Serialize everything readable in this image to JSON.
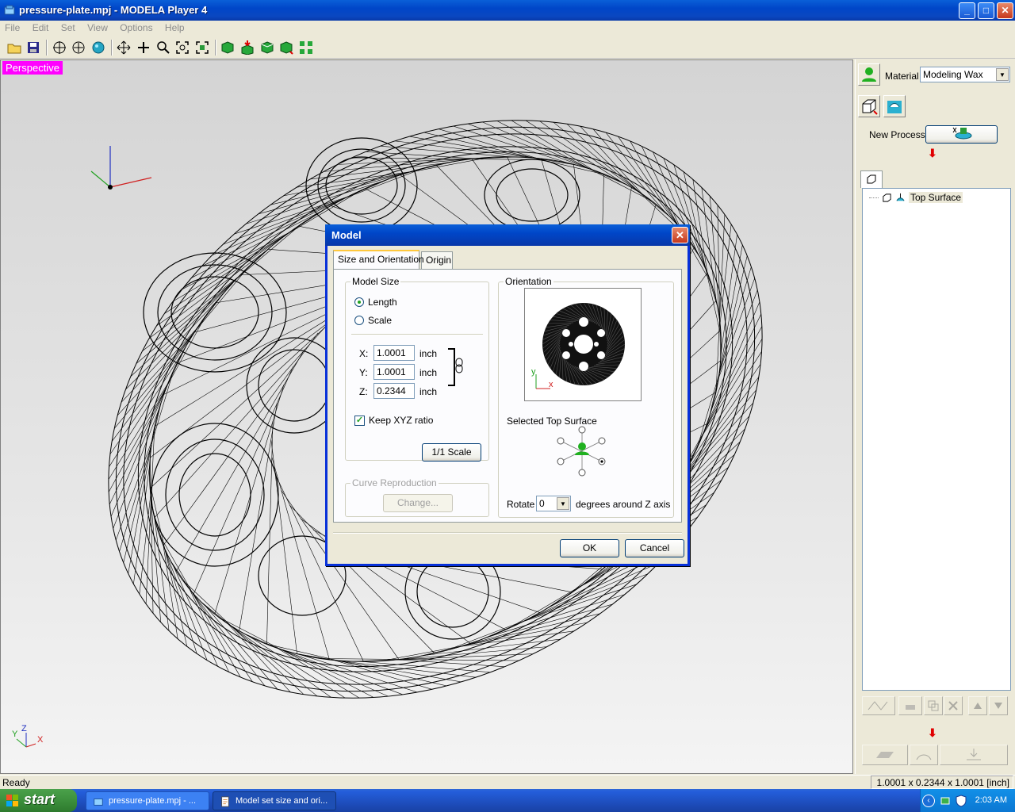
{
  "window": {
    "title": "pressure-plate.mpj - MODELA Player 4",
    "minimize": "_",
    "maximize": "□",
    "close": "✕"
  },
  "menu": [
    "File",
    "Edit",
    "Set",
    "View",
    "Options",
    "Help"
  ],
  "viewport": {
    "label": "Perspective",
    "triad": {
      "x": "X",
      "y": "Y",
      "z": "Z"
    }
  },
  "panel": {
    "material_label": "Material",
    "material_value": "Modeling Wax",
    "new_process_label": "New Process",
    "tree_item": "Top Surface"
  },
  "status": {
    "left": "Ready",
    "right": "1.0001 x 0.2344 x 1.0001 [inch]"
  },
  "taskbar": {
    "start": "start",
    "tasks": [
      "pressure-plate.mpj - ...",
      "Model set size and ori..."
    ],
    "clock": "2:03 AM"
  },
  "dialog": {
    "title": "Model",
    "close": "✕",
    "tabs": [
      "Size and Orientation",
      "Origin"
    ],
    "model_size": {
      "legend": "Model Size",
      "length_label": "Length",
      "scale_label": "Scale",
      "x_label": "X:",
      "x_value": "1.0001",
      "y_label": "Y:",
      "y_value": "1.0001",
      "z_label": "Z:",
      "z_value": "0.2344",
      "unit": "inch",
      "keep_ratio_label": "Keep XYZ ratio",
      "scale_button": "1/1 Scale"
    },
    "curve": {
      "legend": "Curve Reproduction",
      "change_button": "Change..."
    },
    "orientation": {
      "legend": "Orientation",
      "preview_axis_y": "y",
      "preview_axis_x": "x",
      "selected_top_surface": "Selected Top Surface",
      "rotate_label": "Rotate",
      "rotate_value": "0",
      "rotate_suffix": "degrees around Z axis"
    },
    "ok": "OK",
    "cancel": "Cancel"
  },
  "colors": {
    "accent": "#0a47c0",
    "perspective_label": "#ff00ff"
  }
}
